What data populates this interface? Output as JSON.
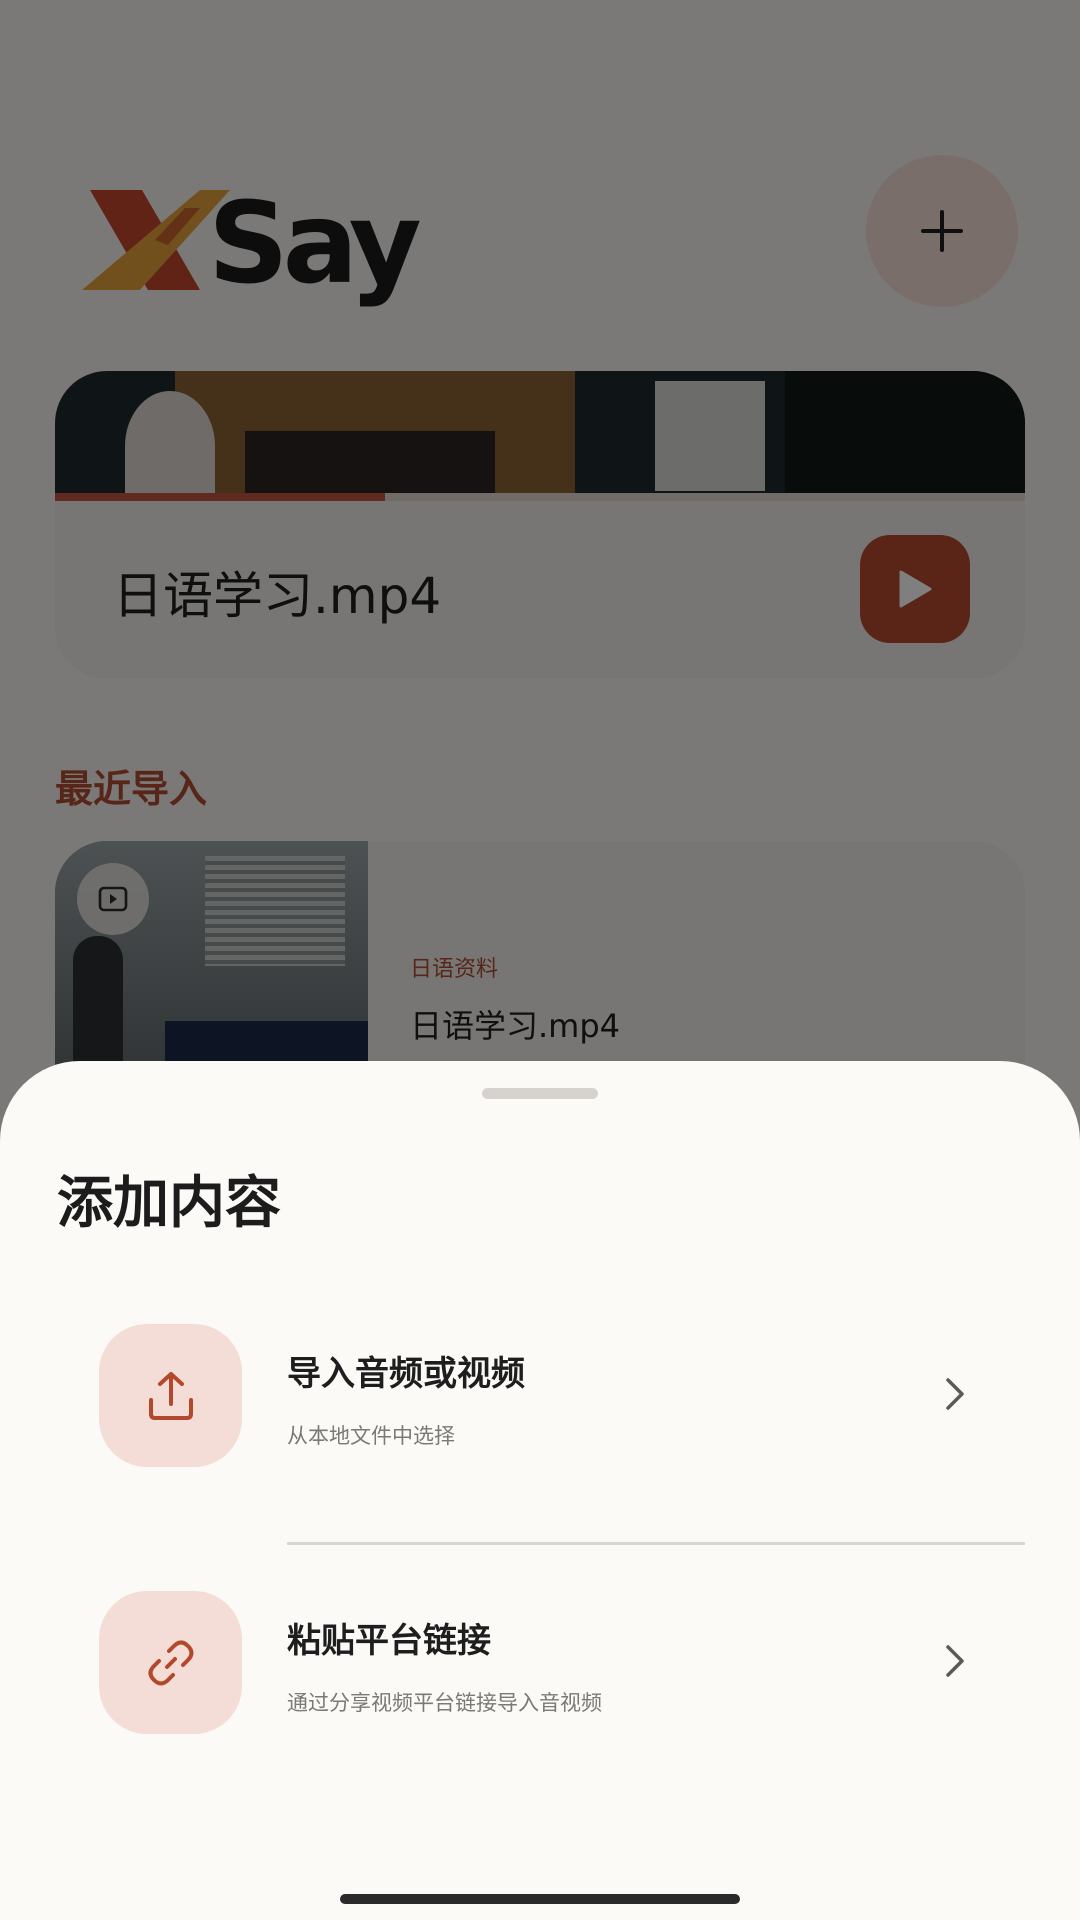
{
  "app": {
    "logo_text": "XSay",
    "now_playing": {
      "title": "日语学习.mp4",
      "progress": 0.34
    },
    "recent": {
      "section_title": "最近导入",
      "items": [
        {
          "tag": "日语资料",
          "title": "日语学习.mp4"
        }
      ]
    }
  },
  "sheet": {
    "title": "添加内容",
    "options": [
      {
        "title": "导入音频或视频",
        "subtitle": "从本地文件中选择",
        "icon": "upload-icon"
      },
      {
        "title": "粘贴平台链接",
        "subtitle": "通过分享视频平台链接导入音视频",
        "icon": "link-icon"
      }
    ]
  },
  "colors": {
    "accent": "#b4482c",
    "accent_soft": "#f4ddd6",
    "sheet_bg": "#fbfaf6"
  }
}
